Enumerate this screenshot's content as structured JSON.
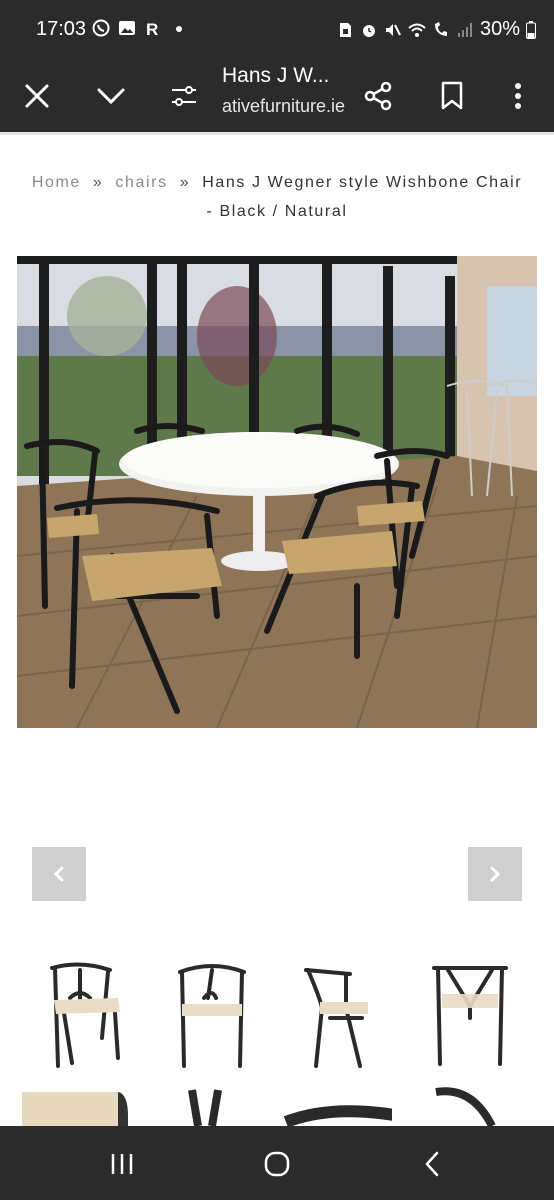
{
  "status_bar": {
    "time": "17:03",
    "left_icons": [
      "whatsapp-icon",
      "image-icon",
      "r-app-icon",
      "dot-icon"
    ],
    "right_icons": [
      "sim-icon",
      "alarm-icon",
      "mute-icon",
      "wifi-icon",
      "wifi-call-icon",
      "signal-icon"
    ],
    "battery": "30%"
  },
  "toolbar": {
    "title": "Hans J W...",
    "url": "ativefurniture.ie",
    "icons": [
      "close-icon",
      "chevron-down-icon",
      "page-settings-icon",
      "share-icon",
      "bookmark-icon",
      "more-icon"
    ]
  },
  "breadcrumb": {
    "home": "Home",
    "separator": "»",
    "category": "chairs",
    "current_line1": "Hans J Wegner style Wishbone Chair",
    "current_line2": "- Black / Natural"
  },
  "hero": {
    "description": "dining room with wishbone chairs around white tulip table"
  },
  "carousel": {
    "prev_icon": "chevron-left-icon",
    "next_icon": "chevron-right-icon"
  },
  "thumbnails": [
    {
      "name": "thumb-chair-front-angle"
    },
    {
      "name": "thumb-chair-front"
    },
    {
      "name": "thumb-chair-side"
    },
    {
      "name": "thumb-chair-back"
    }
  ],
  "colors": {
    "bar_bg": "#2b2b2b",
    "arrow_bg": "#cfcfcf",
    "breadcrumb_link": "#8a8a8a"
  },
  "navbar": {
    "icons": [
      "recent-apps-icon",
      "home-icon",
      "back-icon"
    ]
  }
}
